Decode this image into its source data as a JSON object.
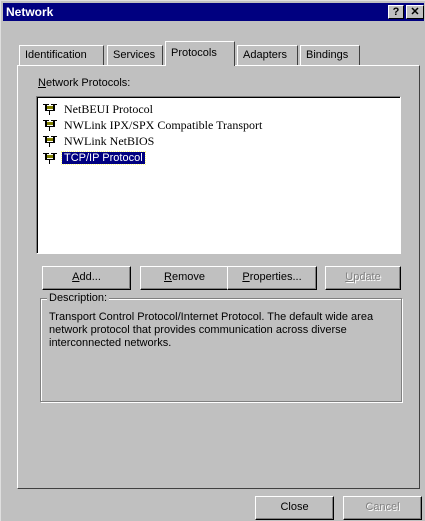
{
  "window": {
    "title": "Network",
    "help_label": "?",
    "close_glyph": "✕"
  },
  "tabs": [
    {
      "label": "Identification",
      "active": false
    },
    {
      "label": "Services",
      "active": false
    },
    {
      "label": "Protocols",
      "active": true
    },
    {
      "label": "Adapters",
      "active": false
    },
    {
      "label": "Bindings",
      "active": false
    }
  ],
  "protocols": {
    "label_prefix": "N",
    "label_rest": "etwork Protocols:",
    "items": [
      {
        "label": "NetBEUI Protocol",
        "icon": "network-protocol-icon",
        "selected": false
      },
      {
        "label": "NWLink IPX/SPX Compatible Transport",
        "icon": "network-protocol-icon",
        "selected": false
      },
      {
        "label": "NWLink NetBIOS",
        "icon": "network-protocol-icon",
        "selected": false
      },
      {
        "label": "TCP/IP Protocol",
        "icon": "network-protocol-icon",
        "selected": true
      }
    ]
  },
  "buttons": {
    "add": {
      "mnemonic": "A",
      "rest": "dd..."
    },
    "remove": {
      "mnemonic": "R",
      "rest": "emove"
    },
    "properties": {
      "mnemonic": "P",
      "rest": "roperties..."
    },
    "update": {
      "mnemonic": "U",
      "rest": "pdate",
      "disabled": true
    }
  },
  "description": {
    "legend": "Description:",
    "text": "Transport Control Protocol/Internet Protocol. The default wide area network protocol that provides communication across diverse interconnected networks."
  },
  "footer": {
    "close_label": "Close",
    "cancel_label": "Cancel"
  }
}
